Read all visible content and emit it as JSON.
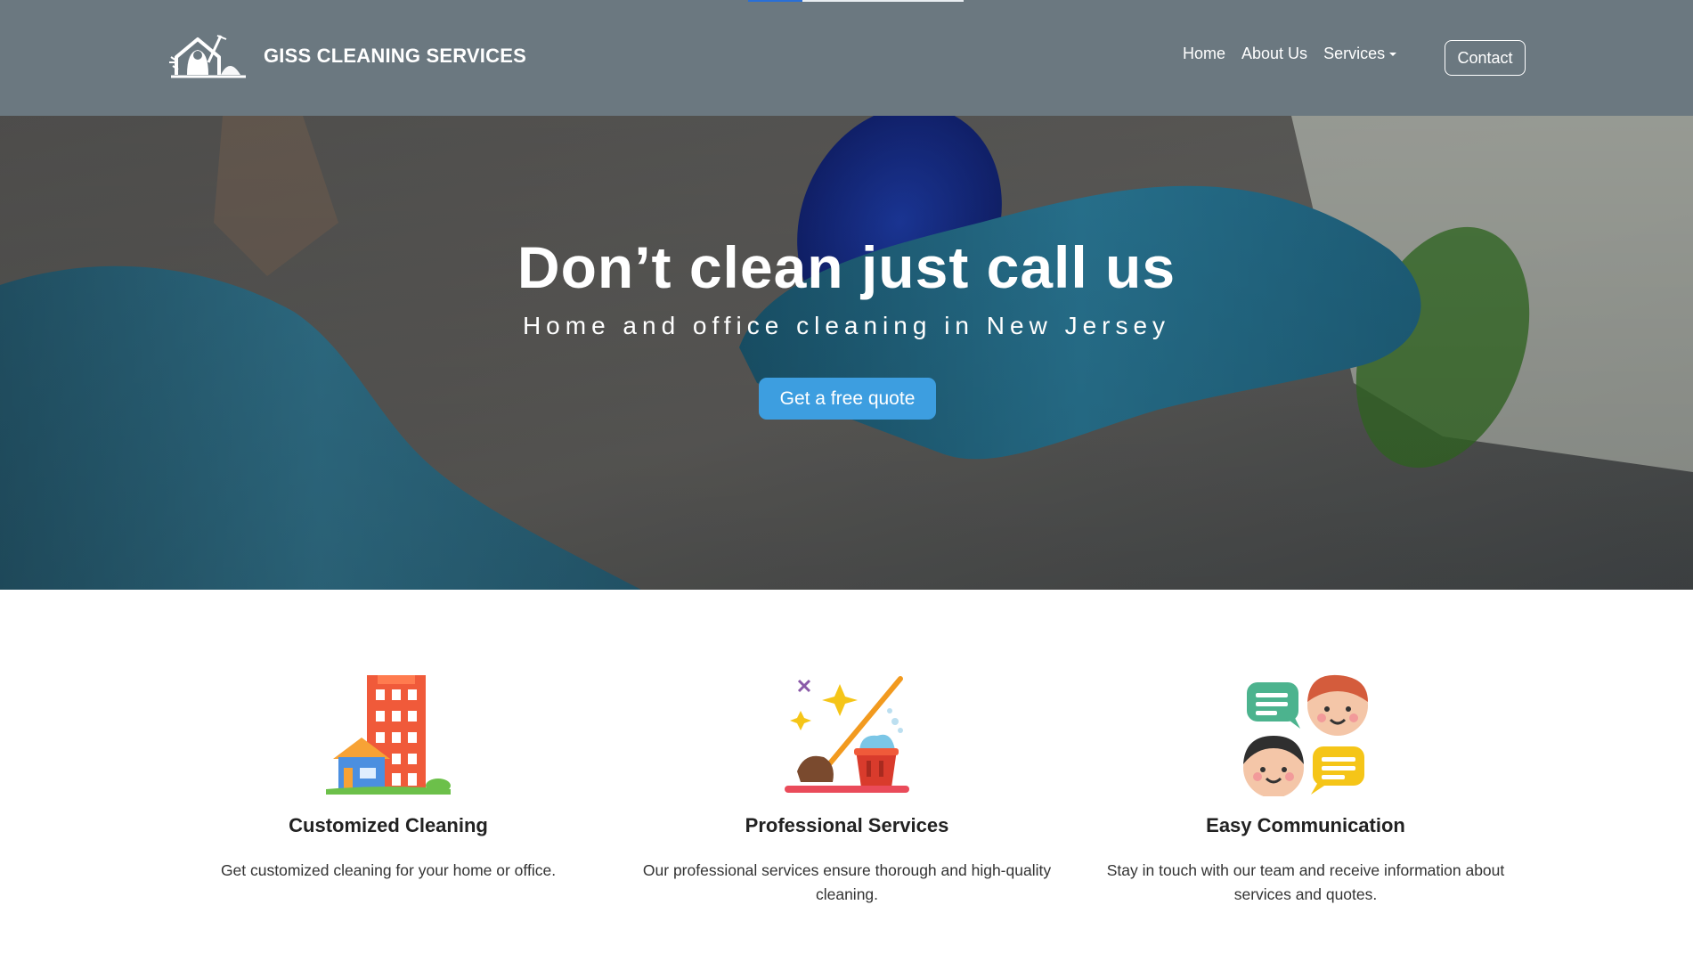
{
  "navbar": {
    "brand_name": "GISS CLEANING SERVICES",
    "links": [
      "Home",
      "About Us",
      "Services"
    ],
    "contact_label": "Contact",
    "page_progress_fraction": 0.25
  },
  "hero": {
    "title": "Don’t clean just call us",
    "subtitle": "Home and office cleaning in New Jersey",
    "cta_label": "Get a free quote"
  },
  "features": [
    {
      "icon": "building-house-icon",
      "title": "Customized Cleaning",
      "text": "Get customized cleaning for your home or office."
    },
    {
      "icon": "cleaning-broom-bucket-icon",
      "title": "Professional Services",
      "text": "Our professional services ensure thorough and high-quality cleaning."
    },
    {
      "icon": "chat-people-icon",
      "title": "Easy Communication",
      "text": "Stay in touch with our team and receive information about services and quotes."
    }
  ],
  "colors": {
    "navbar_bg": "#6b7880",
    "cta_bg": "#3d9ee0",
    "progress": "#2a6fd6"
  }
}
